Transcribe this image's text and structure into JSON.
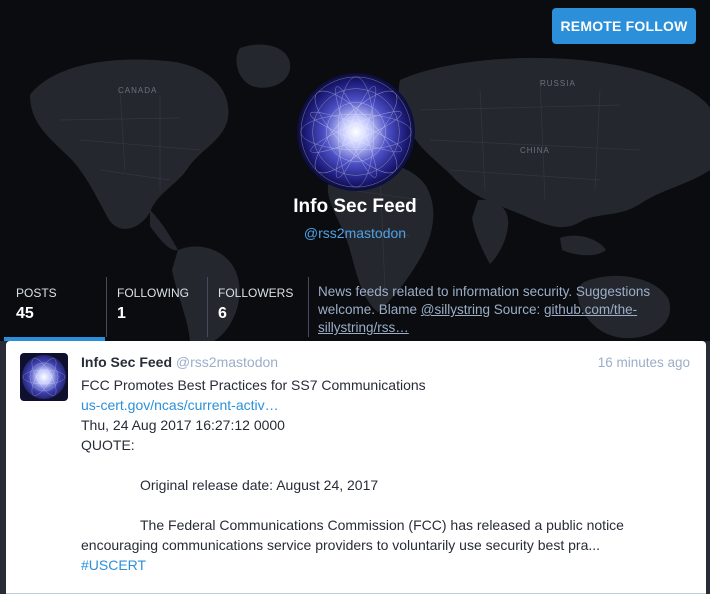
{
  "header": {
    "remote_follow_label": "REMOTE FOLLOW",
    "display_name": "Info Sec Feed",
    "username": "@rss2mastodon",
    "map_labels": [
      "CANADA",
      "RUSSIA",
      "CHINA"
    ]
  },
  "counters": [
    {
      "label": "POSTS",
      "value": "45",
      "active": true
    },
    {
      "label": "FOLLOWING",
      "value": "1",
      "active": false
    },
    {
      "label": "FOLLOWERS",
      "value": "6",
      "active": false
    }
  ],
  "bio": {
    "text_1": "News feeds related to information security. Suggestions welcome. Blame ",
    "mention": "@sillystring",
    "text_2": " Source: ",
    "link": "github.com/the-sillystring/rss…"
  },
  "status": {
    "display_name": "Info Sec Feed",
    "username": "@rss2mastodon",
    "time": "16 minutes ago",
    "title": "FCC Promotes Best Practices for SS7 Communications",
    "link": "us-cert.gov/ncas/current-activ…",
    "date": "Thu, 24 Aug 2017 16:27:12  0000",
    "quote_label": "QUOTE:",
    "release_date": "Original release date: August 24, 2017",
    "body_para_1": "The Federal Communications Commission (FCC) has released a public notice",
    "body_para_2": "encouraging communications service providers to voluntarily use security best pra...",
    "hashtag": "#USCERT"
  },
  "colors": {
    "accent": "#2b90d9",
    "header_bg": "#0b0c0f",
    "bio_text": "#9baec8",
    "username_link": "#4ea2e6",
    "status_bg": "#ffffff"
  },
  "icons": {
    "profile_avatar": "mandala-avatar",
    "status_avatar": "mandala-avatar"
  }
}
